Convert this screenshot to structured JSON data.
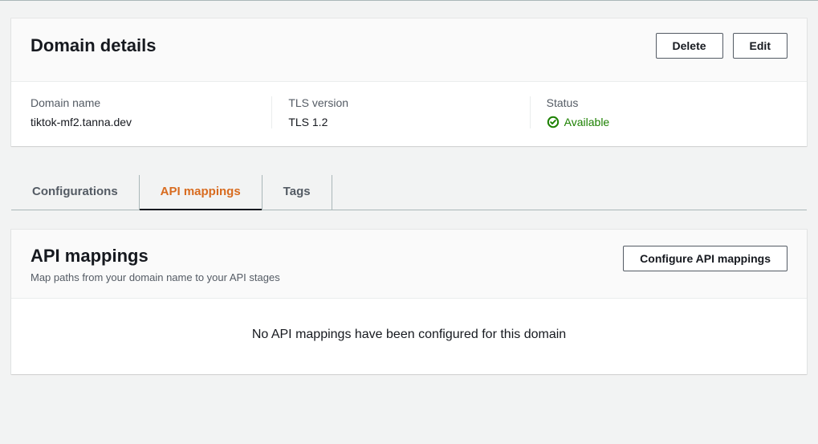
{
  "domainDetails": {
    "title": "Domain details",
    "deleteLabel": "Delete",
    "editLabel": "Edit",
    "cols": {
      "domainNameLabel": "Domain name",
      "domainNameValue": "tiktok-mf2.tanna.dev",
      "tlsLabel": "TLS version",
      "tlsValue": "TLS 1.2",
      "statusLabel": "Status",
      "statusValue": "Available"
    }
  },
  "tabs": {
    "configurations": "Configurations",
    "apiMappings": "API mappings",
    "tags": "Tags"
  },
  "apiMappings": {
    "title": "API mappings",
    "subtitle": "Map paths from your domain name to your API stages",
    "configureLabel": "Configure API mappings",
    "emptyText": "No API mappings have been configured for this domain"
  }
}
